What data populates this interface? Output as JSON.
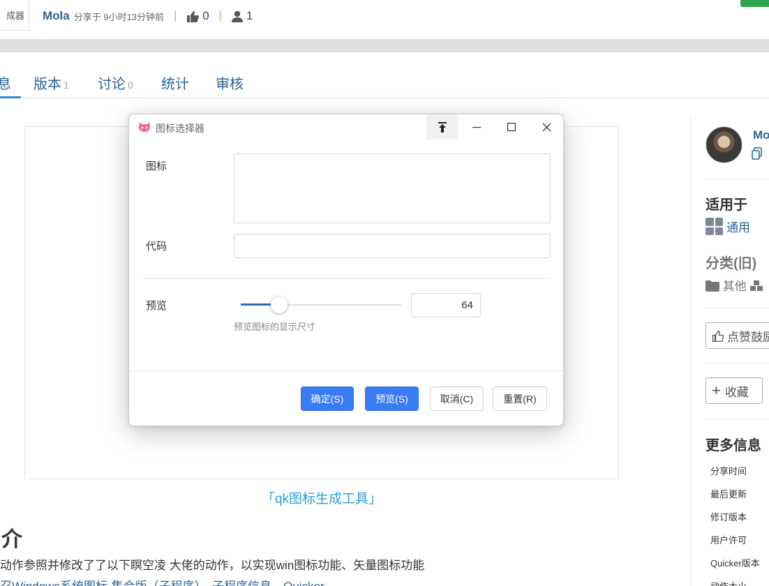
{
  "header": {
    "thumb_text": "成器",
    "author": "Mola",
    "shared_text": "分享于 9小时13分钟前",
    "likes": "0",
    "users": "1"
  },
  "tabs": [
    {
      "label": "息",
      "count": ""
    },
    {
      "label": "版本",
      "count": "1"
    },
    {
      "label": "讨论",
      "count": "0"
    },
    {
      "label": "统计",
      "count": ""
    },
    {
      "label": "审核",
      "count": ""
    }
  ],
  "content": {
    "caption": "「qk图标生成工具」",
    "intro_heading": "介",
    "intro_text": "动作参照并修改了了以下瞑空凌 大佬的动作，以实现win图标功能、矢量图标功能",
    "intro_links": "召Windows系统图标-集合版（子程序）、子程序信息、Quicker"
  },
  "sidebar": {
    "user_name": "Mo",
    "copy_icon": "copy-icon",
    "applies_title": "适用于",
    "applies_value": "通用",
    "category_title": "分类(旧)",
    "category_value": "其他",
    "like_button": "点赞鼓励",
    "fav_button": "收藏",
    "more_info_title": "更多信息",
    "info_items": [
      "分享时间",
      "最后更新",
      "修订版本",
      "用户许可",
      "Quicker版本",
      "动作大小"
    ]
  },
  "dialog": {
    "title": "图标选择器",
    "icon_label": "图标",
    "icon_value": "",
    "code_label": "代码",
    "code_value": "",
    "preview_label": "预览",
    "preview_size": "64",
    "preview_hint": "预览图标的显示尺寸",
    "slider_fraction": 0.24,
    "buttons": {
      "ok": "确定(S)",
      "preview": "预览(S)",
      "cancel": "取消(C)",
      "reset": "重置(R)"
    },
    "colors": {
      "primary": "#3a7cf4",
      "slider": "#2d63c4"
    }
  }
}
